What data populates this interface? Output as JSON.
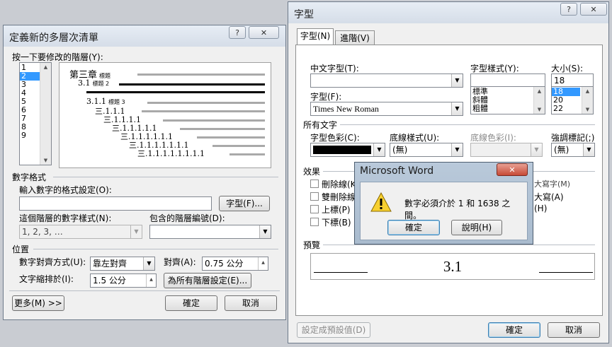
{
  "multilevel_dialog": {
    "title": "定義新的多層次清單",
    "help_btn": "?",
    "close_btn": "✕",
    "level_prompt": "按一下要修改的階層(Y):",
    "levels": [
      "1",
      "2",
      "3",
      "4",
      "5",
      "6",
      "7",
      "8",
      "9"
    ],
    "selected_level": "2",
    "preview": {
      "heading": "第三章",
      "heading_suffix": "標題",
      "level2": "3.1",
      "level2_suffix": "標題 2",
      "level3": "3.1.1",
      "level3_suffix": "標題 3",
      "rows": [
        "三.1.1.1",
        "三.1.1.1.1",
        "三.1.1.1.1.1",
        "三.1.1.1.1.1.1",
        "三.1.1.1.1.1.1.1",
        "三.1.1.1.1.1.1.1.1"
      ]
    },
    "number_format_section": "數字格式",
    "format_label": "輸入數字的格式設定(O):",
    "format_value": "",
    "font_button": "字型(F)...",
    "style_label": "這個階層的數字樣式(N):",
    "style_value": "1, 2, 3, …",
    "include_label": "包含的階層編號(D):",
    "include_value": "",
    "position_section": "位置",
    "align_label": "數字對齊方式(U):",
    "align_value": "靠左對齊",
    "align_at_label": "對齊(A):",
    "align_at_value": "0.75 公分",
    "indent_label": "文字縮排於(I):",
    "indent_value": "1.5 公分",
    "all_levels_button": "為所有階層設定(E)...",
    "more_button": "更多(M) >>",
    "ok_button": "確定",
    "cancel_button": "取消"
  },
  "font_dialog": {
    "title": "字型",
    "help_btn": "?",
    "close_btn": "✕",
    "tabs": [
      "字型(N)",
      "進階(V)"
    ],
    "cjk_font_label": "中文字型(T):",
    "cjk_font_value": "",
    "font_label": "字型(F):",
    "font_value": "Times New Roman",
    "style_label": "字型樣式(Y):",
    "style_value": "",
    "style_options": [
      "標準",
      "斜體",
      "粗體"
    ],
    "size_label": "大小(S):",
    "size_value": "18",
    "size_options": [
      "18",
      "20",
      "22"
    ],
    "all_text_section": "所有文字",
    "font_color_label": "字型色彩(C):",
    "font_color": "#000000",
    "underline_style_label": "底線樣式(U):",
    "underline_style_value": "(無)",
    "underline_color_label": "底線色彩(I):",
    "emphasis_label": "強調標記(;)",
    "emphasis_value": "(無)",
    "effects_section": "效果",
    "effects_left": [
      "刪除線(K)",
      "雙刪除線(L)",
      "上標(P)",
      "下標(B)"
    ],
    "effects_right": [
      "大寫字(M)",
      "大寫(A)",
      "(H)"
    ],
    "preview_section": "預覽",
    "preview_text": "3.1",
    "default_button": "設定成預設值(D)",
    "ok_button": "確定",
    "cancel_button": "取消"
  },
  "alert": {
    "title": "Microsoft Word",
    "close_btn": "✕",
    "message": "數字必須介於 1 和 1638 之間。",
    "ok_button": "確定",
    "help_button": "說明(H)"
  }
}
